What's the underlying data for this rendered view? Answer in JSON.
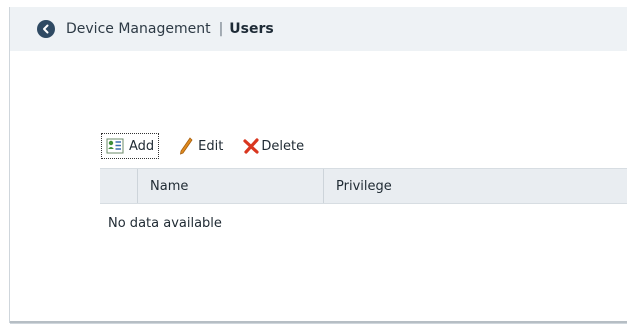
{
  "header": {
    "section": "Device Management",
    "separator": "|",
    "current": "Users"
  },
  "toolbar": {
    "add_label": "Add",
    "edit_label": "Edit",
    "delete_label": "Delete"
  },
  "grid": {
    "columns": [
      "Name",
      "Privilege"
    ],
    "empty_message": "No data available"
  },
  "icons": {
    "back": "chevron-left-circle-icon",
    "add": "add-user-icon",
    "edit": "pencil-icon",
    "delete": "red-x-icon"
  },
  "colors": {
    "header_bg": "#eef2f5",
    "back_button": "#2f4a63",
    "delete_icon": "#d9361f",
    "edit_icon": "#e08a1e",
    "grid_header_bg": "#e9edf1"
  }
}
